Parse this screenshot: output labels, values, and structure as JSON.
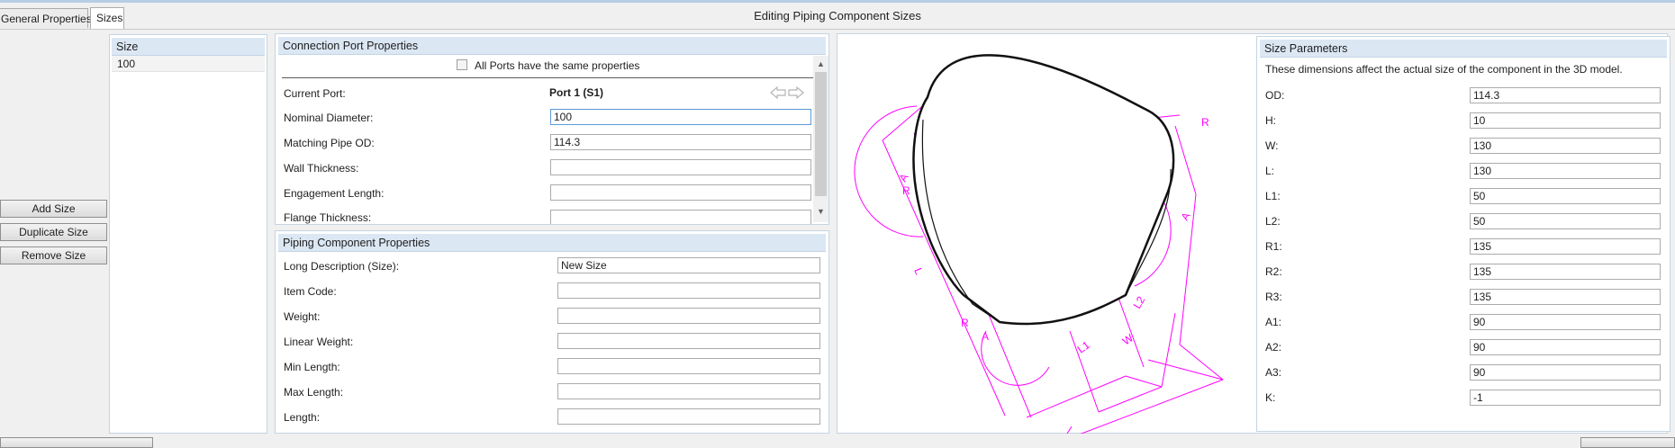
{
  "tabs": [
    {
      "label": "General Properties"
    },
    {
      "label": "Sizes"
    }
  ],
  "window_title": "Editing Piping Component Sizes",
  "size_list": {
    "header": "Size",
    "items": [
      "100"
    ]
  },
  "buttons": {
    "add_size": "Add Size",
    "duplicate_size": "Duplicate Size",
    "remove_size": "Remove Size"
  },
  "connection_port": {
    "title": "Connection Port Properties",
    "same_props_label": "All Ports have the same properties",
    "same_props_checked": false,
    "current_port_label": "Current Port:",
    "current_port_value": "Port 1 (S1)",
    "fields": [
      {
        "label": "Nominal Diameter:",
        "value": "100"
      },
      {
        "label": "Matching Pipe OD:",
        "value": "114.3"
      },
      {
        "label": "Wall Thickness:",
        "value": ""
      },
      {
        "label": "Engagement Length:",
        "value": ""
      },
      {
        "label": "Flange Thickness:",
        "value": ""
      }
    ]
  },
  "piping_component": {
    "title": "Piping Component Properties",
    "fields": [
      {
        "label": "Long Description (Size):",
        "value": "New Size"
      },
      {
        "label": "Item Code:",
        "value": ""
      },
      {
        "label": "Weight:",
        "value": ""
      },
      {
        "label": "Linear Weight:",
        "value": ""
      },
      {
        "label": "Min Length:",
        "value": ""
      },
      {
        "label": "Max Length:",
        "value": ""
      },
      {
        "label": "Length:",
        "value": ""
      }
    ]
  },
  "drawing": {
    "labels": {
      "R": "R",
      "A": "A",
      "L": "L",
      "L1": "L1",
      "L2": "L2",
      "W": "W"
    },
    "dimension_color": "#ff00ff"
  },
  "size_parameters": {
    "title": "Size Parameters",
    "description": "These dimensions affect the actual size of the component in the 3D model.",
    "params": [
      {
        "label": "OD:",
        "value": "114.3"
      },
      {
        "label": "H:",
        "value": "10"
      },
      {
        "label": "W:",
        "value": "130"
      },
      {
        "label": "L:",
        "value": "130"
      },
      {
        "label": "L1:",
        "value": "50"
      },
      {
        "label": "L2:",
        "value": "50"
      },
      {
        "label": "R1:",
        "value": "135"
      },
      {
        "label": "R2:",
        "value": "135"
      },
      {
        "label": "R3:",
        "value": "135"
      },
      {
        "label": "A1:",
        "value": "90"
      },
      {
        "label": "A2:",
        "value": "90"
      },
      {
        "label": "A3:",
        "value": "90"
      },
      {
        "label": "K:",
        "value": "-1"
      }
    ]
  },
  "colors": {
    "panel_header": "#dce7f4",
    "panel_border": "#c5d4e3",
    "focus_border": "#5b9bd5"
  }
}
